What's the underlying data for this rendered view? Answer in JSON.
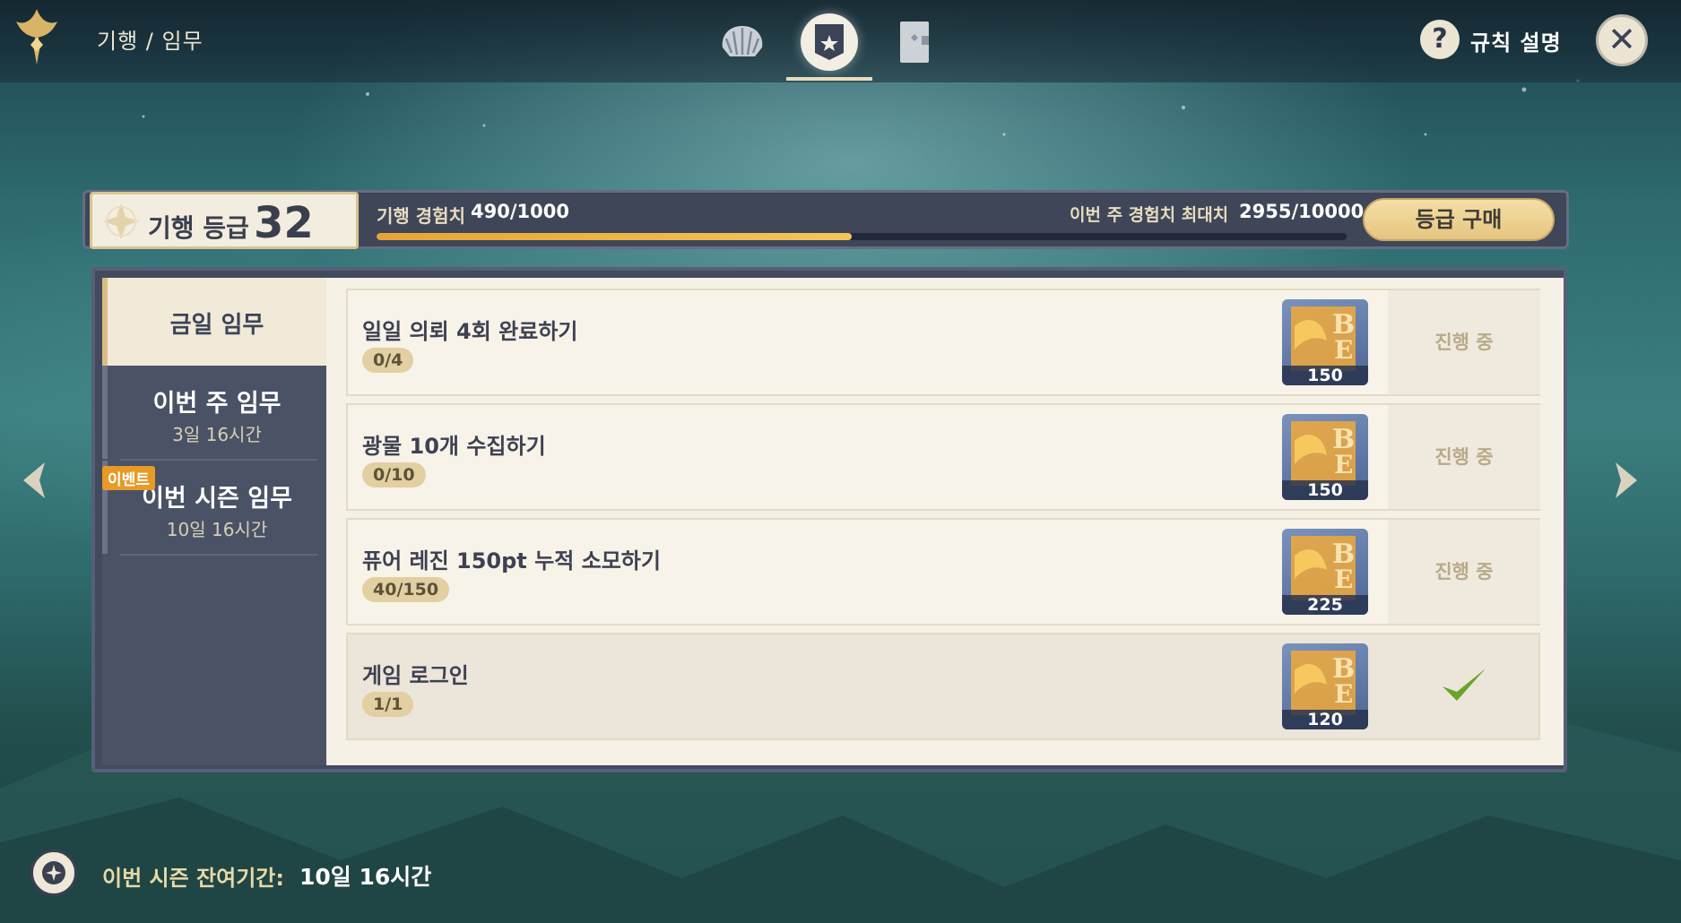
{
  "breadcrumb": "기행 / 임무",
  "help": {
    "label": "규칙 설명",
    "symbol": "?"
  },
  "close": {
    "symbol": "✕"
  },
  "level": {
    "label": "기행 등급",
    "value": "32"
  },
  "exp": {
    "label": "기행 경험치",
    "value": "490/1000",
    "progress_fraction": 0.49,
    "weekly_label": "이번 주 경험치 최대치",
    "weekly_value": "2955/10000"
  },
  "buy_label": "등급 구매",
  "sidebar": {
    "items": [
      {
        "title": "금일 임무"
      },
      {
        "title": "이번 주 임무",
        "sub": "3일 16시간"
      },
      {
        "title": "이번 시즌 임무",
        "sub": "10일 16시간",
        "badge": "이벤트"
      }
    ]
  },
  "tasks": [
    {
      "title": "일일 의뢰 4회 완료하기",
      "progress": "0/4",
      "reward": "150",
      "status": "진행 중"
    },
    {
      "title": "광물 10개 수집하기",
      "progress": "0/10",
      "reward": "150",
      "status": "진행 중"
    },
    {
      "title": "퓨어 레진 150pt 누적 소모하기",
      "progress": "40/150",
      "reward": "225",
      "status": "진행 중"
    },
    {
      "title": "게임 로그인",
      "progress": "1/1",
      "reward": "120",
      "status": "completed"
    }
  ],
  "footer": {
    "label": "이번 시즌 잔여기간:",
    "value": "10일 16시간"
  },
  "colors": {
    "accent_gold": "#e7a435",
    "event_orange": "#e89a27",
    "complete_green": "#6aa329"
  },
  "icons": [
    "logo-icon",
    "shell-tab-icon",
    "mission-tab-icon",
    "notice-tab-icon",
    "help-icon",
    "close-icon",
    "level-star-icon",
    "reward-exp-icon",
    "checkmark-icon",
    "left-arrow-icon",
    "right-arrow-icon",
    "season-icon"
  ]
}
